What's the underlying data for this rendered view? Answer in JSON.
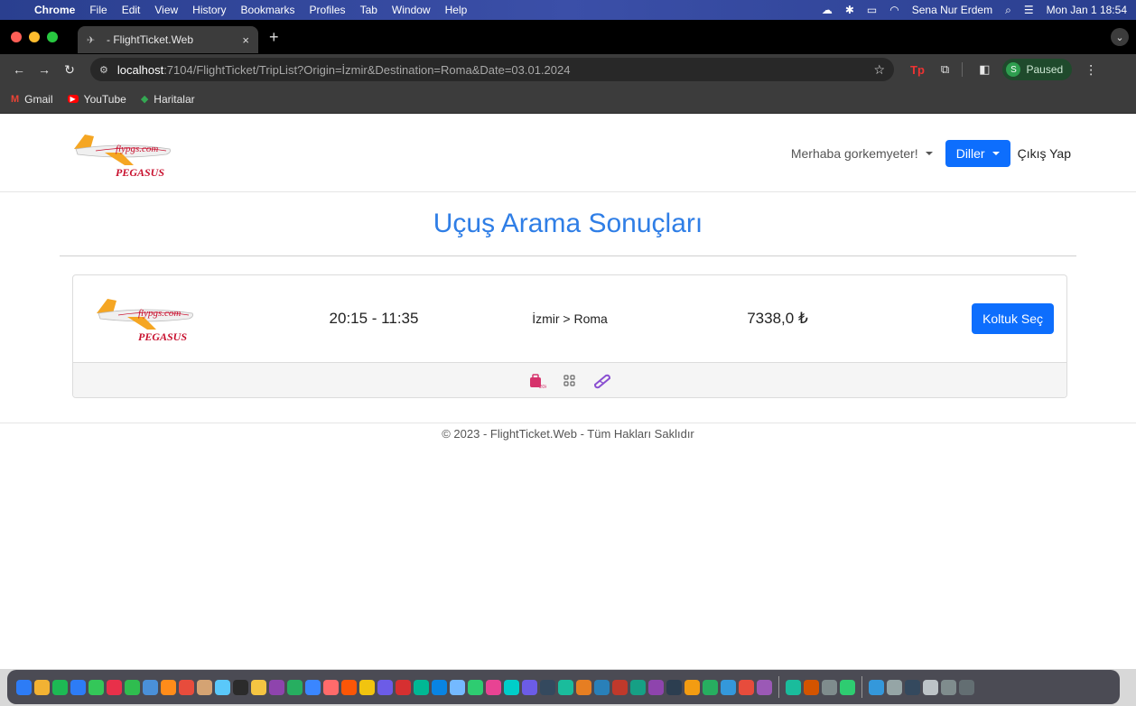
{
  "menubar": {
    "app": "Chrome",
    "items": [
      "File",
      "Edit",
      "View",
      "History",
      "Bookmarks",
      "Profiles",
      "Tab",
      "Window",
      "Help"
    ],
    "user": "Sena Nur Erdem",
    "clock": "Mon Jan 1  18:54"
  },
  "browser": {
    "tab_title": "- FlightTicket.Web",
    "url_host": "localhost",
    "url_path": ":7104/FlightTicket/TripList?Origin=İzmir&Destination=Roma&Date=03.01.2024",
    "profile_initial": "S",
    "profile_status": "Paused",
    "bookmarks": [
      "Gmail",
      "YouTube",
      "Haritalar"
    ]
  },
  "header": {
    "greeting": "Merhaba gorkemyeter!",
    "languages": "Diller",
    "logout": "Çıkış Yap",
    "logo_text": "flypgs.com",
    "logo_brand": "PEGASUS"
  },
  "main": {
    "title": "Uçuş Arama Sonuçları",
    "results": [
      {
        "times": "20:15 - 11:35",
        "route": "İzmir > Roma",
        "price": "7338,0 ₺",
        "action": "Koltuk Seç",
        "amenities": [
          "baggage-icon",
          "seat-icon",
          "meal-icon"
        ]
      }
    ]
  },
  "footer": {
    "copyright": "© 2023 - FlightTicket.Web - Tüm Hakları Saklıdır"
  },
  "colors": {
    "primary": "#0d6efd",
    "title": "#2f7ee6",
    "logo_orange": "#f5a623",
    "logo_red": "#c8102e"
  },
  "dock_colors": [
    "#2d7cf6",
    "#f2b233",
    "#1db954",
    "#2d7cf6",
    "#34c759",
    "#e8304a",
    "#2fbd4f",
    "#4a90d9",
    "#ff8c1a",
    "#e74c3c",
    "#d4a373",
    "#5ac8fa",
    "#2b2b2b",
    "#f5c542",
    "#8e44ad",
    "#27ae60",
    "#3a86ff",
    "#ff6b6b",
    "#fb5607",
    "#f1c40f",
    "#6c5ce7",
    "#d63031",
    "#00b894",
    "#0984e3",
    "#74b9ff",
    "#2ecc71",
    "#e84393",
    "#00cec9",
    "#6c5ce7",
    "#34495e",
    "#1abc9c",
    "#e67e22",
    "#2980b9",
    "#c0392b",
    "#16a085",
    "#8e44ad",
    "#2c3e50",
    "#f39c12",
    "#27ae60",
    "#3498db",
    "#e74c3c",
    "#9b59b6",
    "#1abc9c",
    "#d35400",
    "#7f8c8d",
    "#2ecc71",
    "#3498db",
    "#95a5a6",
    "#34495e",
    "#bdc3c7",
    "#7f8c8d",
    "#636e72"
  ]
}
